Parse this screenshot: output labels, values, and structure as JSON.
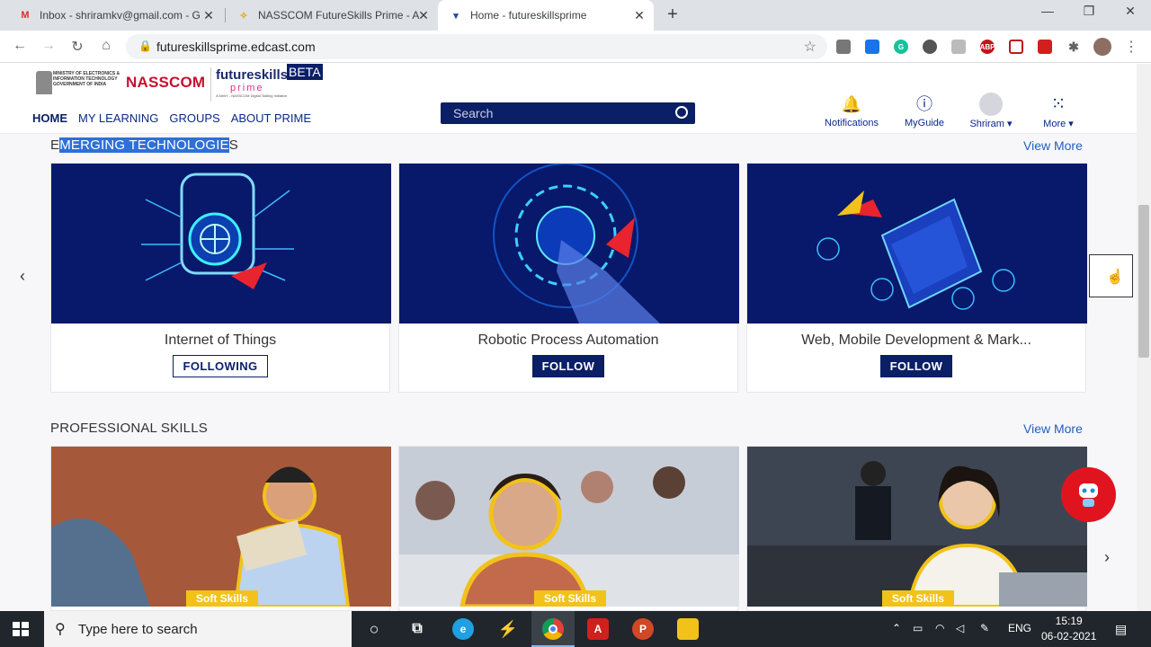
{
  "browser": {
    "tabs": [
      {
        "title": "Inbox - shriramkv@gmail.com - G",
        "icon": "gmail-icon"
      },
      {
        "title": "NASSCOM FutureSkills Prime - A",
        "icon": "nasscom-icon"
      },
      {
        "title": "Home - futureskillsprime",
        "icon": "futureskills-icon"
      }
    ],
    "url": "futureskillsprime.edcast.com"
  },
  "site": {
    "ministry": "MINISTRY OF ELECTRONICS & INFORMATION TECHNOLOGY GOVERNMENT OF INDIA",
    "nasscom": "NASSCOM",
    "brand_line1": "futureskills",
    "brand_line2": "prime",
    "brand_tagline": "A MeitY - NASSCOM Digital Skilling Initiative",
    "beta": "BETA",
    "nav": [
      "HOME",
      "MY LEARNING",
      "GROUPS",
      "ABOUT PRIME"
    ],
    "search_placeholder": "Search",
    "header_icons": {
      "notifications": "Notifications",
      "myguide": "MyGuide",
      "user": "Shriram ▾",
      "more": "More ▾"
    }
  },
  "emerging": {
    "title_pre": "E",
    "title_hl": "MERGING TECHNOLOGIE",
    "title_post": "S",
    "view_more": "View More",
    "cards": [
      {
        "name": "Internet of Things",
        "button": "FOLLOWING"
      },
      {
        "name": "Robotic Process Automation",
        "button": "FOLLOW"
      },
      {
        "name": "Web, Mobile Development & Mark...",
        "button": "FOLLOW"
      }
    ]
  },
  "professional": {
    "title": "PROFESSIONAL SKILLS",
    "view_more": "View More",
    "cards": [
      {
        "tag": "Soft Skills"
      },
      {
        "tag": "Soft Skills"
      },
      {
        "tag": "Soft Skills"
      }
    ]
  },
  "taskbar": {
    "search_placeholder": "Type here to search",
    "lang": "ENG",
    "time": "15:19",
    "date": "06-02-2021"
  },
  "colors": {
    "brand_navy": "#0b1f66",
    "accent_red": "#e0141f",
    "link_blue": "#1f5fbf"
  }
}
